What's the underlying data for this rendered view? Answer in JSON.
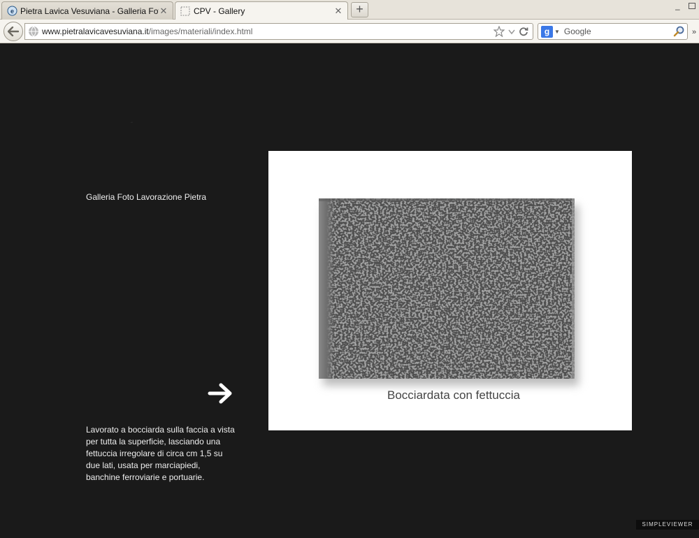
{
  "browser": {
    "tabs": [
      {
        "title": "Pietra Lavica Vesuviana - Galleria Fotogr...",
        "active": false
      },
      {
        "title": "CPV - Gallery",
        "active": true
      }
    ],
    "url": {
      "domain": "www.pietralavicavesuviana.it",
      "path": "/images/materiali/index.html"
    },
    "search": {
      "engine": "g-logo-icon",
      "placeholder": "Google"
    },
    "icons": [
      "back-arrow-icon",
      "globe-icon",
      "star-icon",
      "dropdown-arrow-icon",
      "reload-icon",
      "magnifier-icon",
      "close-icon",
      "plus-icon",
      "minimize-icon",
      "restore-icon"
    ]
  },
  "page": {
    "gallery_title": "Galleria Foto Lavorazione Pietra",
    "caption": "Lavorato a bocciarda sulla faccia a vista per tutta la superficie, lasciando una fettuccia irregolare di circa cm 1,5 su due lati, usata per marciapiedi, banchine ferroviarie e portuarie.",
    "photo_caption": "Bocciardata con fettuccia",
    "badge": "SIMPLEVIEWER",
    "colors": {
      "background": "#1a1a1a",
      "frame": "#ffffff",
      "text": "#eeeeee"
    }
  }
}
